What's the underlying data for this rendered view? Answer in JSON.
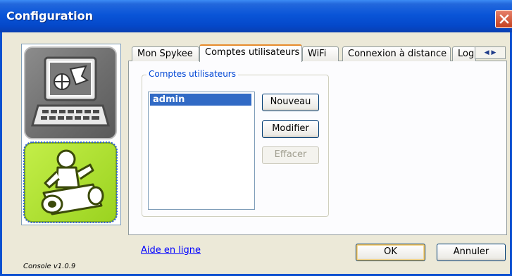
{
  "window": {
    "title": "Configuration"
  },
  "tabs": [
    {
      "label": "Mon Spykee"
    },
    {
      "label": "Comptes utilisateurs"
    },
    {
      "label": "WiFi"
    },
    {
      "label": "Connexion à distance"
    },
    {
      "label": "Log"
    }
  ],
  "active_tab": "Comptes utilisateurs",
  "users_group": {
    "title": "Comptes utilisateurs",
    "users": [
      "admin"
    ],
    "selected_user": "admin",
    "buttons": {
      "new": "Nouveau",
      "modify": "Modifier",
      "delete": "Effacer"
    }
  },
  "footer": {
    "help_link": "Aide en ligne",
    "ok_label": "OK",
    "cancel_label": "Annuler",
    "version": "Console v1.0.9"
  },
  "icons": [
    "laptop-robot-icon",
    "robot-icon"
  ],
  "colors": {
    "titlebar": "#0a55d8",
    "selected_row": "#316ac5",
    "active_tab_accent": "#e68b2c",
    "robot_tile": "#b3e634"
  }
}
